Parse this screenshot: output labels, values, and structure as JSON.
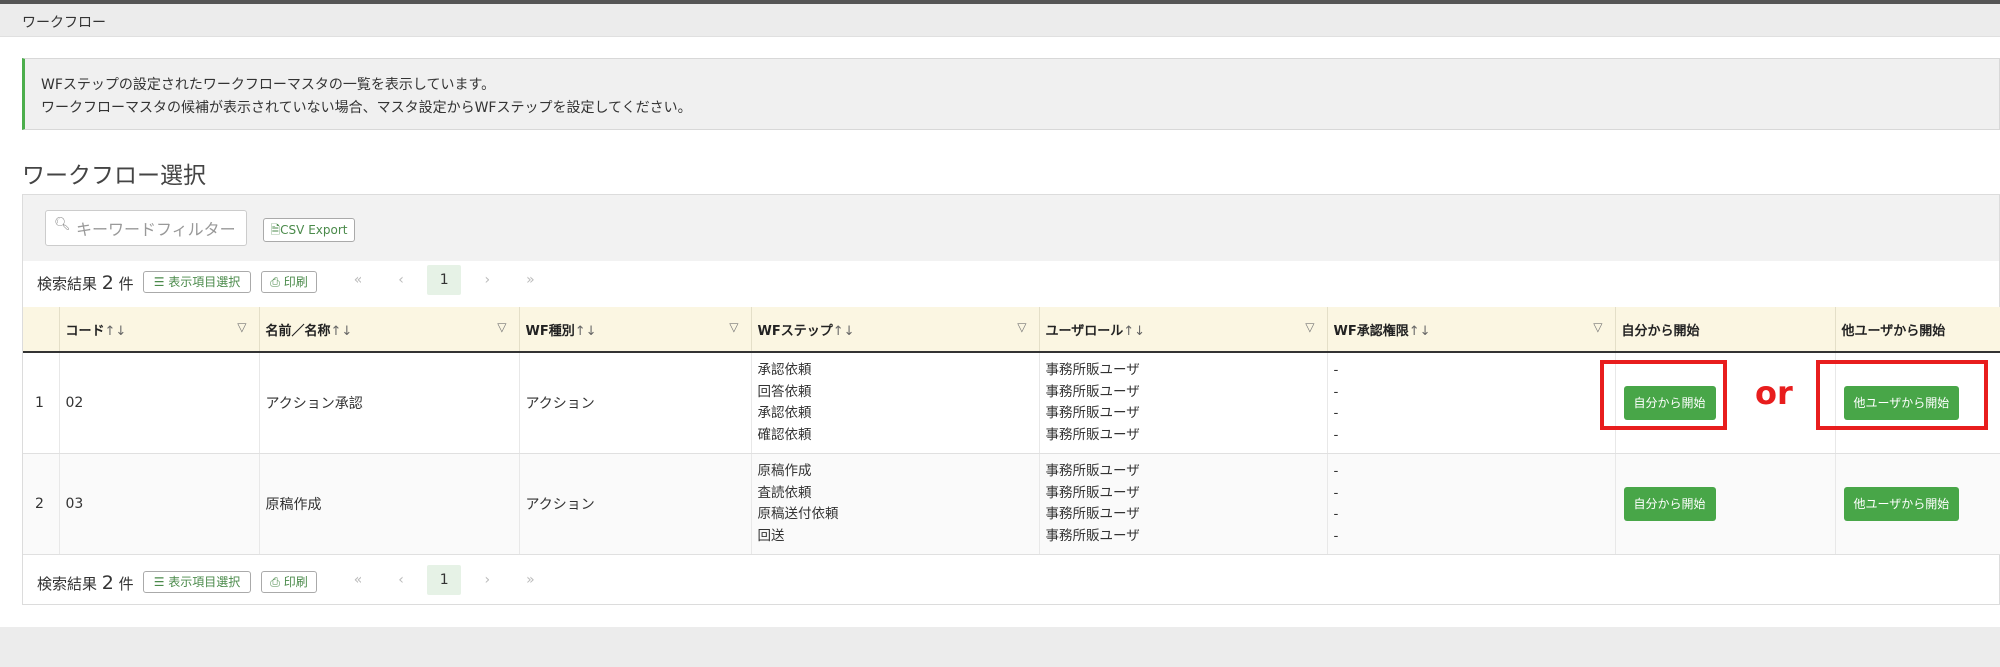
{
  "breadcrumb": "ワークフロー",
  "info": {
    "line1": "WFステップの設定されたワークフローマスタの一覧を表示しています。",
    "line2": "ワークフローマスタの候補が表示されていない場合、マスタ設定からWFステップを設定してください。"
  },
  "section_title": "ワークフロー選択",
  "search": {
    "placeholder": "キーワードフィルター"
  },
  "csv_export": "CSV Export",
  "results": {
    "label": "検索結果",
    "count": "2",
    "unit": "件"
  },
  "buttons": {
    "column_select": "表示項目選択",
    "print": "印刷"
  },
  "pager": {
    "first": "«",
    "prev": "‹",
    "current": "1",
    "next": "›",
    "last": "»"
  },
  "columns": [
    "コード",
    "名前／名称",
    "WF種別",
    "WFステップ",
    "ユーザロール",
    "WF承認権限",
    "自分から開始",
    "他ユーザから開始"
  ],
  "sort_glyph": "↑↓",
  "filter_glyph": "▽",
  "rows": [
    {
      "no": "1",
      "code": "02",
      "name": "アクション承認",
      "type": "アクション",
      "steps": [
        "承認依頼",
        "回答依頼",
        "承認依頼",
        "確認依頼"
      ],
      "roles": [
        "事務所販ユーザ",
        "事務所販ユーザ",
        "事務所販ユーザ",
        "事務所販ユーザ"
      ],
      "auth": [
        "-",
        "-",
        "-",
        "-"
      ],
      "start_self": "自分から開始",
      "start_other": "他ユーザから開始"
    },
    {
      "no": "2",
      "code": "03",
      "name": "原稿作成",
      "type": "アクション",
      "steps": [
        "原稿作成",
        "査読依頼",
        "原稿送付依頼",
        "回送"
      ],
      "roles": [
        "事務所販ユーザ",
        "事務所販ユーザ",
        "事務所販ユーザ",
        "事務所販ユーザ"
      ],
      "auth": [
        "-",
        "-",
        "-",
        "-"
      ],
      "start_self": "自分から開始",
      "start_other": "他ユーザから開始"
    }
  ],
  "annotation": {
    "or_text": "or",
    "highlight_color": "#e81d1d"
  },
  "colors": {
    "accent_green": "#48a648",
    "header_bg": "#fbf6e2"
  }
}
